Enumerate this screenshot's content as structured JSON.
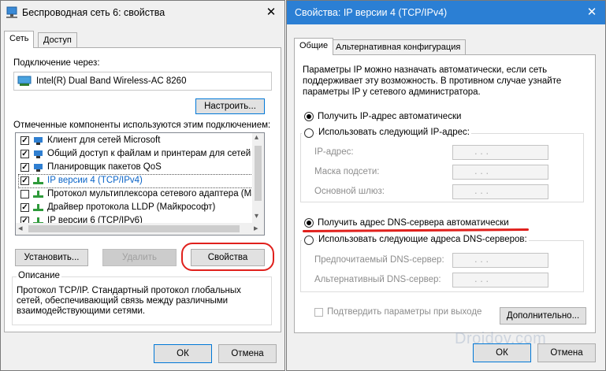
{
  "left_window": {
    "title": "Беспроводная сеть 6: свойства",
    "close_glyph": "✕",
    "tabs": [
      "Сеть",
      "Доступ"
    ],
    "connect_via_label": "Подключение через:",
    "adapter_name": "Intel(R) Dual Band Wireless-AC 8260",
    "configure_button": "Настроить...",
    "components_label": "Отмеченные компоненты используются этим подключением:",
    "components": [
      {
        "label": "Клиент для сетей Microsoft",
        "checked": true
      },
      {
        "label": "Общий доступ к файлам и принтерам для сетей Mi",
        "checked": true
      },
      {
        "label": "Планировщик пакетов QoS",
        "checked": true
      },
      {
        "label": "IP версии 4 (TCP/IPv4)",
        "checked": true
      },
      {
        "label": "Протокол мультиплексора сетевого адаптера (Май",
        "checked": false
      },
      {
        "label": "Драйвер протокола LLDP (Майкрософт)",
        "checked": true
      },
      {
        "label": "IP версии 6 (TCP/IPv6)",
        "checked": true
      }
    ],
    "scroll_left": "◂",
    "scroll_right": "▸",
    "scroll_up": "▴",
    "scroll_down": "▾",
    "install_button": "Установить...",
    "remove_button": "Удалить",
    "properties_button": "Свойства",
    "description_title": "Описание",
    "description_text": [
      "Протокол TCP/IP. Стандартный протокол глобальных",
      "сетей, обеспечивающий связь между различными",
      "взаимодействующими сетями."
    ],
    "ok_button": "ОК",
    "cancel_button": "Отмена"
  },
  "right_window": {
    "title": "Свойства: IP версии 4 (TCP/IPv4)",
    "close_glyph": "✕",
    "tabs": [
      "Общие",
      "Альтернативная конфигурация"
    ],
    "intro_text": [
      "Параметры IP можно назначать автоматически, если сеть",
      "поддерживает эту возможность. В противном случае узнайте",
      "параметры IP у сетевого администратора."
    ],
    "radio_auto_ip": "Получить IP-адрес автоматически",
    "radio_manual_ip": "Использовать следующий IP-адрес:",
    "ip_address_label": "IP-адрес:",
    "subnet_label": "Маска подсети:",
    "gateway_label": "Основной шлюз:",
    "ip_dots": ". . .",
    "radio_auto_dns": "Получить адрес DNS-сервера автоматически",
    "radio_manual_dns": "Использовать следующие адреса DNS-серверов:",
    "preferred_dns_label": "Предпочитаемый DNS-сервер:",
    "alternate_dns_label": "Альтернативный DNS-сервер:",
    "validate_on_exit": "Подтвердить параметры при выходе",
    "advanced_button": "Дополнительно...",
    "ok_button": "ОК",
    "cancel_button": "Отмена"
  },
  "watermark": "Droidov.com",
  "colors": {
    "highlight": "#e0201c",
    "accent": "#0078d7",
    "window_bg": "#f0f0f0"
  }
}
